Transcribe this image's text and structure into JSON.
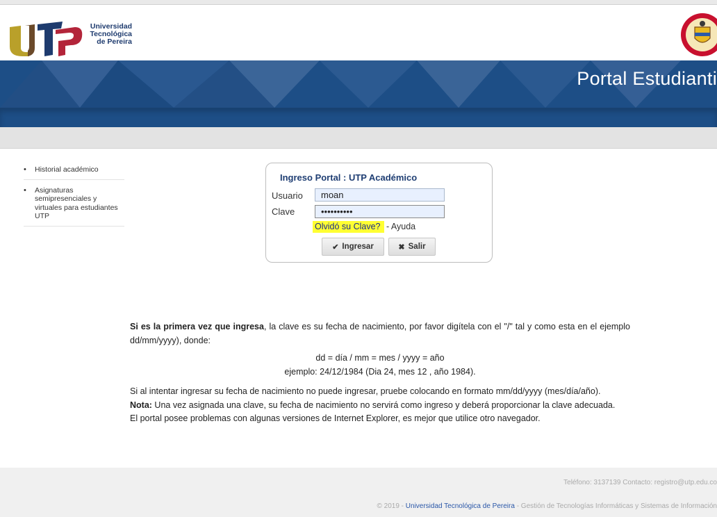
{
  "header": {
    "logo_mark": "UTP",
    "logo_text_line1": "Universidad",
    "logo_text_line2": "Tecnológica",
    "logo_text_line3": "de Pereira",
    "portal_title": "Portal Estudianti"
  },
  "sidebar": {
    "items": [
      {
        "label": "Historial académico"
      },
      {
        "label": "Asignaturas semipresenciales y virtuales para estudiantes UTP"
      }
    ]
  },
  "login": {
    "title": "Ingreso Portal : UTP Académico",
    "user_label": "Usuario",
    "user_value": "moan",
    "password_label": "Clave",
    "password_value": "••••••••••",
    "forgot_link": "Olvidó su Clave?",
    "separator": " - ",
    "help_link": "Ayuda",
    "submit_label": "Ingresar",
    "exit_label": "Salir"
  },
  "instructions": {
    "p1_bold": "Si es la primera vez que ingresa",
    "p1_rest": ", la clave es su fecha de nacimiento, por favor digítela con el \"/\" tal y como esta en el ejemplo dd/mm/yyyy), donde:",
    "format_line": "dd = día / mm = mes / yyyy = año",
    "example_line": "ejemplo: 24/12/1984 (Dia 24, mes 12 , año 1984).",
    "p2": "Si al intentar ingresar su fecha de nacimiento no puede ingresar, pruebe colocando en formato mm/dd/yyyy (mes/día/año).",
    "note_bold": "Nota:",
    "note_rest": " Una vez asignada una clave, su fecha de nacimiento no servirá como ingreso y deberá proporcionar la clave adecuada.",
    "p3": "El portal posee problemas con algunas versiones de Internet Explorer, es mejor que utilice otro navegador."
  },
  "footer": {
    "contact": "Teléfono: 3137139 Contacto: registro@utp.edu.co",
    "copyright": "© 2019 - ",
    "university_link": "Universidad Tecnológica de Pereira",
    "dept": " - Gestión de Tecnologías Informáticas y Sistemas de Información"
  },
  "colors": {
    "banner": "#1d4e86",
    "title_blue": "#1f3e73",
    "highlight": "#ffff33"
  }
}
